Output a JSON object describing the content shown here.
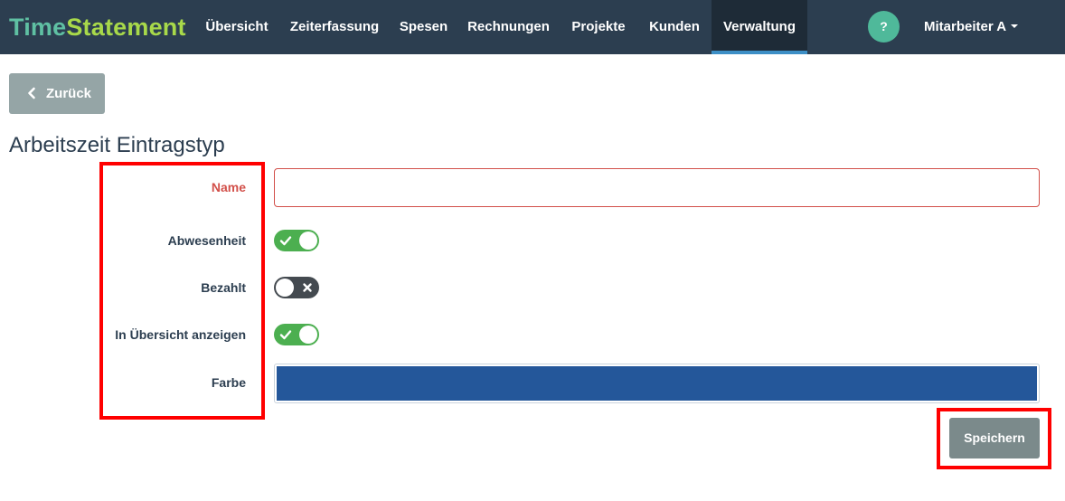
{
  "app": {
    "brand_part1": "Time",
    "brand_part2": "Statement",
    "brand_color1": "#5fc0a3",
    "brand_color2": "#a8d94a"
  },
  "nav": {
    "items": [
      {
        "label": "Übersicht"
      },
      {
        "label": "Zeiterfassung"
      },
      {
        "label": "Spesen"
      },
      {
        "label": "Rechnungen"
      },
      {
        "label": "Projekte"
      },
      {
        "label": "Kunden"
      },
      {
        "label": "Verwaltung",
        "active": true
      }
    ],
    "help_label": "?",
    "user_label": "Mitarbeiter A"
  },
  "back_button": {
    "label": "Zurück",
    "icon": "chevron-left-icon"
  },
  "page_title": "Arbeitszeit Eintragstyp",
  "form": {
    "name_label": "Name",
    "name_value": "",
    "absence_label": "Abwesenheit",
    "absence_on": true,
    "paid_label": "Bezahlt",
    "paid_on": false,
    "show_overview_label": "In Übersicht anzeigen",
    "show_overview_on": true,
    "color_label": "Farbe",
    "color_value": "#24579a"
  },
  "save_button": {
    "label": "Speichern"
  },
  "colors": {
    "navbar": "#2c3e50",
    "toggle_on": "#4caf50",
    "toggle_off": "#444a50",
    "error": "#d2504a",
    "highlight": "#ff0000"
  }
}
